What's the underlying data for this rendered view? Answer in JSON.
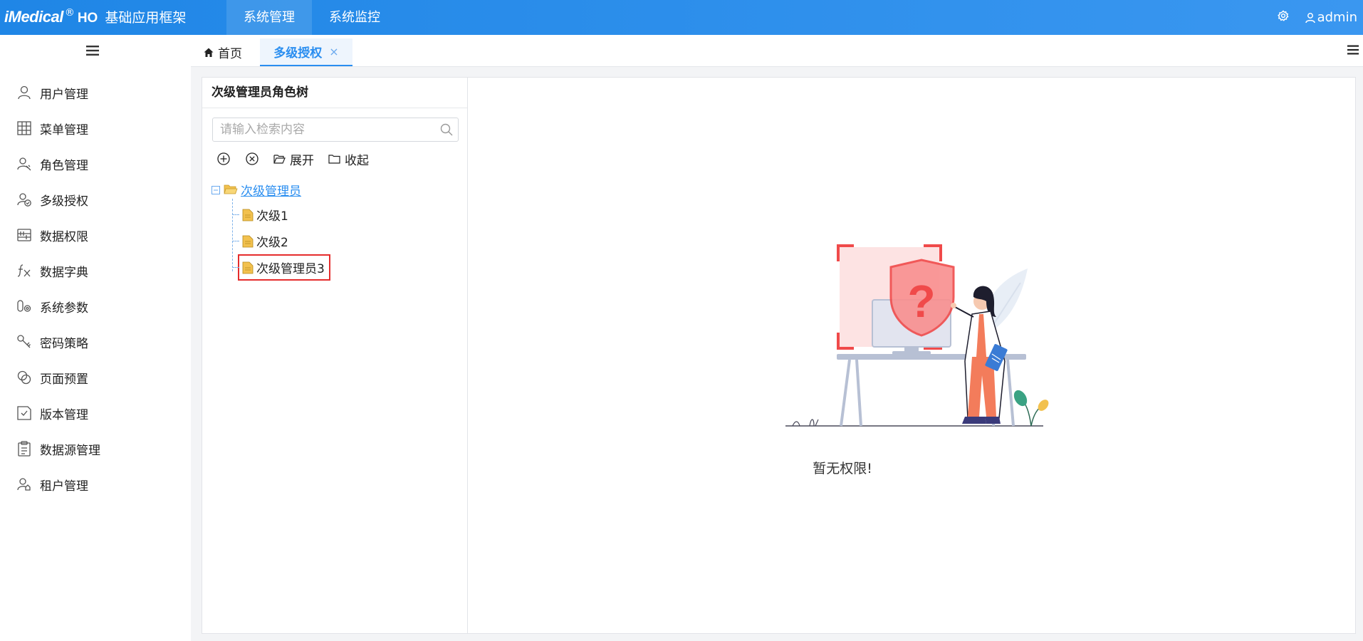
{
  "brand": {
    "logo": "iMedical",
    "reg": "®",
    "ho": "HO",
    "title": "基础应用框架"
  },
  "topnav": [
    {
      "label": "系统管理",
      "active": true
    },
    {
      "label": "系统监控",
      "active": false
    }
  ],
  "user": {
    "name": "admin"
  },
  "sidebar": {
    "items": [
      {
        "label": "用户管理",
        "icon": "user-icon"
      },
      {
        "label": "菜单管理",
        "icon": "grid-icon"
      },
      {
        "label": "角色管理",
        "icon": "role-icon"
      },
      {
        "label": "多级授权",
        "icon": "user-check-icon"
      },
      {
        "label": "数据权限",
        "icon": "data-permission-icon"
      },
      {
        "label": "数据字典",
        "icon": "fx-icon"
      },
      {
        "label": "系统参数",
        "icon": "param-icon"
      },
      {
        "label": "密码策略",
        "icon": "key-icon"
      },
      {
        "label": "页面预置",
        "icon": "overlap-circles-icon"
      },
      {
        "label": "版本管理",
        "icon": "version-icon"
      },
      {
        "label": "数据源管理",
        "icon": "clipboard-icon"
      },
      {
        "label": "租户管理",
        "icon": "tenant-icon"
      }
    ]
  },
  "tabs": {
    "home": "首页",
    "active": "多级授权",
    "close": "×"
  },
  "tree_panel": {
    "title": "次级管理员角色树",
    "search_placeholder": "请输入检索内容",
    "expand_label": "展开",
    "collapse_label": "收起",
    "root": {
      "label": "次级管理员",
      "expander": "⊟"
    },
    "children": [
      {
        "label": "次级1",
        "selected": false
      },
      {
        "label": "次级2",
        "selected": false
      },
      {
        "label": "次级管理员3",
        "selected": true
      }
    ]
  },
  "content": {
    "empty_text": "暂无权限!",
    "illustration_symbol": "?"
  },
  "colors": {
    "topbar": "#2a8ef0",
    "accent": "#2a8ef0",
    "selected_outline": "#e52d2d",
    "illus_red": "#f04a4a"
  }
}
